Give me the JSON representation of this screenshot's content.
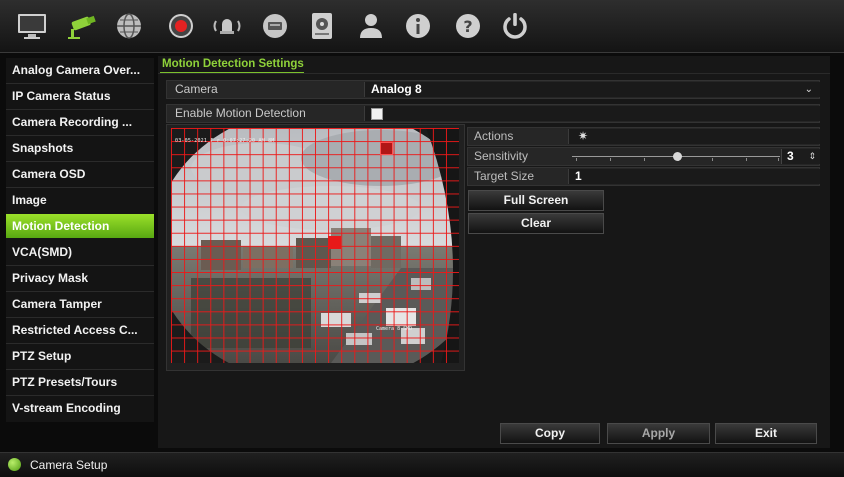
{
  "toolbar": {
    "icons": [
      "monitor-icon",
      "camera-icon",
      "network-icon",
      "record-icon",
      "alarm-icon",
      "device-icon",
      "storage-icon",
      "user-icon",
      "info-icon",
      "help-icon",
      "power-icon"
    ]
  },
  "sidebar": {
    "items": [
      {
        "label": "Analog Camera Over..."
      },
      {
        "label": "IP Camera Status"
      },
      {
        "label": "Camera Recording ..."
      },
      {
        "label": "Snapshots"
      },
      {
        "label": "Camera OSD"
      },
      {
        "label": "Image"
      },
      {
        "label": "Motion Detection",
        "active": true
      },
      {
        "label": "VCA(SMD)"
      },
      {
        "label": "Privacy Mask"
      },
      {
        "label": "Camera Tamper"
      },
      {
        "label": "Restricted Access C..."
      },
      {
        "label": "PTZ Setup"
      },
      {
        "label": "PTZ Presets/Tours"
      },
      {
        "label": "V-stream Encoding"
      }
    ]
  },
  "main": {
    "title": "Motion Detection Settings",
    "camera_label": "Camera",
    "camera_value": "Analog 8",
    "enable_label": "Enable Motion Detection",
    "enable_checked": false,
    "preview": {
      "osd_text": "03-05-2021 F r 0:07:27:20 AM 8M",
      "camera_label": "Camera 8 SMD"
    },
    "actions_label": "Actions",
    "sensitivity_label": "Sensitivity",
    "sensitivity_value": "3",
    "target_size_label": "Target Size",
    "target_size_value": "1",
    "full_screen_label": "Full Screen",
    "clear_label": "Clear",
    "copy_label": "Copy",
    "apply_label": "Apply",
    "exit_label": "Exit"
  },
  "status": {
    "text": "Camera Setup"
  },
  "colors": {
    "accent": "#7cc22d",
    "grid": "#e81919"
  }
}
